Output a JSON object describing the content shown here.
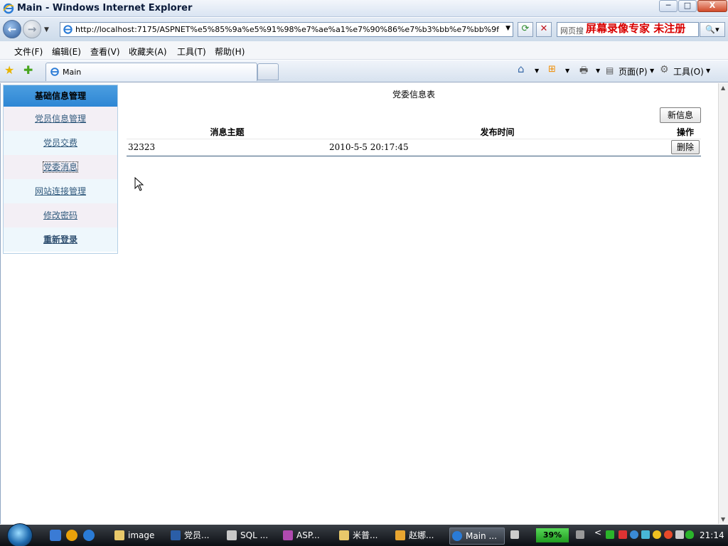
{
  "window": {
    "title": "Main - Windows Internet Explorer",
    "min_glyph": "─",
    "max_glyph": "□",
    "close_glyph": "X"
  },
  "address": {
    "url": "http://localhost:7175/ASPNET%e5%85%9a%e5%91%98%e7%ae%a1%e7%90%86%e7%b3%bb%e7%bb%9f/Admin/ir",
    "search_placeholder": "网页搜",
    "watermark": "屏幕录像专家  未注册"
  },
  "menu": [
    "文件(F)",
    "编辑(E)",
    "查看(V)",
    "收藏夹(A)",
    "工具(T)",
    "帮助(H)"
  ],
  "tabs": {
    "active": "Main"
  },
  "commands": {
    "page": "页面(P)",
    "tools": "工具(O)"
  },
  "sidebar": {
    "title": "基础信息管理",
    "items": [
      {
        "label": "党员信息管理"
      },
      {
        "label": "党员交费"
      },
      {
        "label": "党委消息"
      },
      {
        "label": "网站连接管理"
      },
      {
        "label": "修改密码"
      },
      {
        "label": "重新登录"
      }
    ]
  },
  "main": {
    "title": "党委信息表",
    "new_button": "新信息",
    "columns": [
      "消息主题",
      "发布时间",
      "操作"
    ],
    "rows": [
      {
        "subject": "32323",
        "time": "2010-5-5 20:17:45",
        "action": "删除"
      }
    ]
  },
  "taskbar": {
    "tasks": [
      "image",
      "党员...",
      "SQL ...",
      "ASP...",
      "米普...",
      "赵娜...",
      "Main ..."
    ],
    "battery": "39%",
    "clock": "21:14"
  },
  "colors": {
    "sidebar_header": "#2d86d4",
    "link": "#315a7d",
    "watermark": "#d80000"
  }
}
